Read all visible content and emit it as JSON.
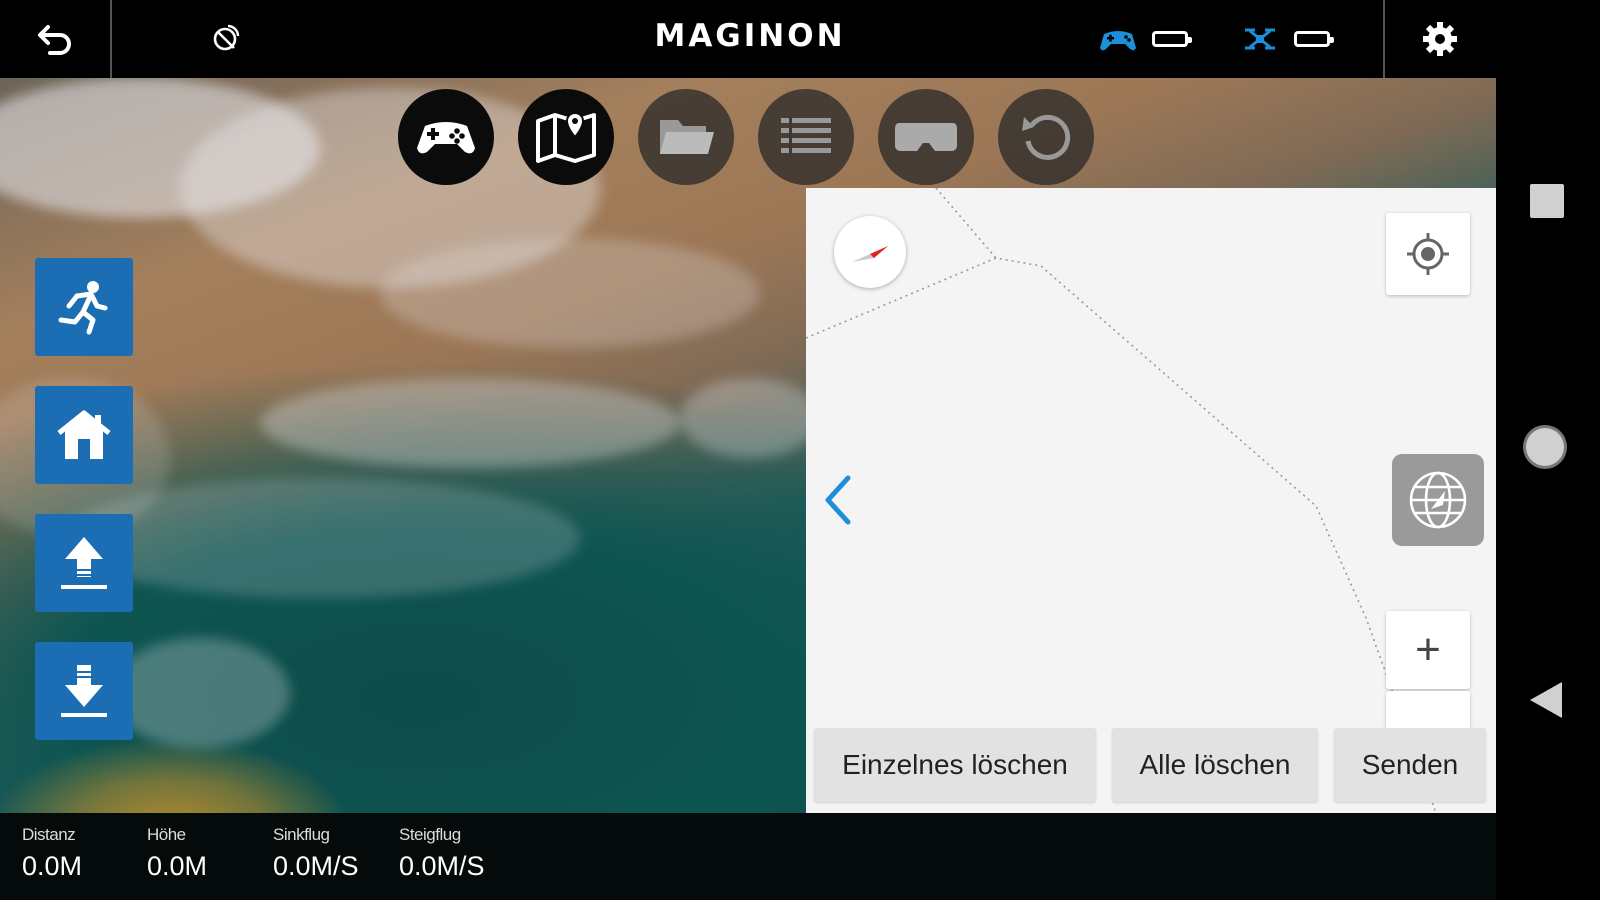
{
  "app": {
    "brand": "MAGINON"
  },
  "topbar": {
    "back_icon": "undo-arrow-icon",
    "gps_icon": "satellite-icon",
    "controller_status_icon": "gamepad-icon",
    "drone_status_icon": "drone-icon",
    "settings_icon": "gear-icon",
    "accent_color": "#1b8fd8"
  },
  "modes": [
    {
      "icon": "gamepad-icon",
      "active": true
    },
    {
      "icon": "map-pin-icon",
      "active": true
    },
    {
      "icon": "folder-icon",
      "active": false
    },
    {
      "icon": "list-icon",
      "active": false
    },
    {
      "icon": "vr-goggles-icon",
      "active": false
    },
    {
      "icon": "rotate-icon",
      "active": false
    }
  ],
  "side_buttons": [
    {
      "icon": "follow-me-runner-icon"
    },
    {
      "icon": "home-icon"
    },
    {
      "icon": "takeoff-icon"
    },
    {
      "icon": "landing-icon"
    }
  ],
  "map": {
    "locate_icon": "crosshair-icon",
    "compass_icon": "compass-icon",
    "collapse_icon": "chevron-left-icon",
    "globe_icon": "globe-icon",
    "zoom_in_label": "+",
    "buttons": {
      "delete_single": "Einzelnes löschen",
      "delete_all": "Alle löschen",
      "send": "Senden"
    }
  },
  "telemetry": [
    {
      "label": "Distanz",
      "value": "0.0M"
    },
    {
      "label": "Höhe",
      "value": "0.0M"
    },
    {
      "label": "Sinkflug",
      "value": "0.0M/S"
    },
    {
      "label": "Steigflug",
      "value": "0.0M/S"
    }
  ],
  "android_nav": [
    "recent-apps-icon",
    "home-circle-icon",
    "back-triangle-icon"
  ]
}
